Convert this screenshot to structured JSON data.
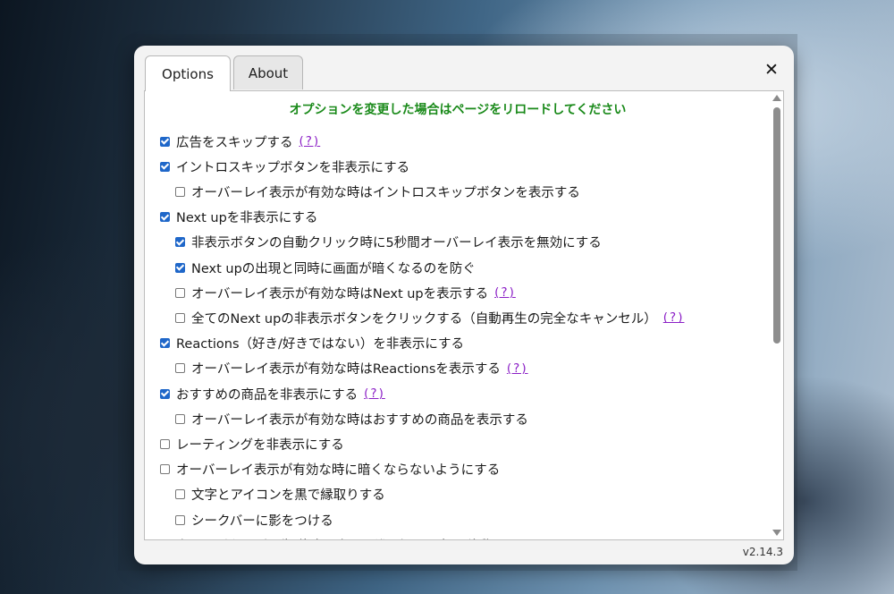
{
  "tabs": [
    {
      "label": "Options",
      "active": true
    },
    {
      "label": "About",
      "active": false
    }
  ],
  "close_label": "✕",
  "notice": "オプションを変更した場合はページをリロードしてください",
  "help_label": "(?)",
  "options": [
    {
      "label": "広告をスキップする",
      "checked": true,
      "indent": 0,
      "help": true
    },
    {
      "label": "イントロスキップボタンを非表示にする",
      "checked": true,
      "indent": 0,
      "help": false
    },
    {
      "label": "オーバーレイ表示が有効な時はイントロスキップボタンを表示する",
      "checked": false,
      "indent": 1,
      "help": false
    },
    {
      "label": "Next upを非表示にする",
      "checked": true,
      "indent": 0,
      "help": false
    },
    {
      "label": "非表示ボタンの自動クリック時に5秒間オーバーレイ表示を無効にする",
      "checked": true,
      "indent": 1,
      "help": false
    },
    {
      "label": "Next upの出現と同時に画面が暗くなるのを防ぐ",
      "checked": true,
      "indent": 1,
      "help": false
    },
    {
      "label": "オーバーレイ表示が有効な時はNext upを表示する",
      "checked": false,
      "indent": 1,
      "help": true
    },
    {
      "label": "全てのNext upの非表示ボタンをクリックする（自動再生の完全なキャンセル）",
      "checked": false,
      "indent": 1,
      "help": true
    },
    {
      "label": "Reactions（好き/好きではない）を非表示にする",
      "checked": true,
      "indent": 0,
      "help": false
    },
    {
      "label": "オーバーレイ表示が有効な時はReactionsを表示する",
      "checked": false,
      "indent": 1,
      "help": true
    },
    {
      "label": "おすすめの商品を非表示にする",
      "checked": true,
      "indent": 0,
      "help": true
    },
    {
      "label": "オーバーレイ表示が有効な時はおすすめの商品を表示する",
      "checked": false,
      "indent": 1,
      "help": false
    },
    {
      "label": "レーティングを非表示にする",
      "checked": false,
      "indent": 0,
      "help": false
    },
    {
      "label": "オーバーレイ表示が有効な時に暗くならないようにする",
      "checked": false,
      "indent": 0,
      "help": false
    },
    {
      "label": "文字とアイコンを黒で縁取りする",
      "checked": false,
      "indent": 1,
      "help": false
    },
    {
      "label": "シークバーに影をつける",
      "checked": false,
      "indent": 1,
      "help": false
    },
    {
      "label": "上下のボタン（再生/停止、戻る、進む）を下部に移動する",
      "checked": false,
      "indent": 0,
      "help": false
    }
  ],
  "version": "v2.14.3"
}
